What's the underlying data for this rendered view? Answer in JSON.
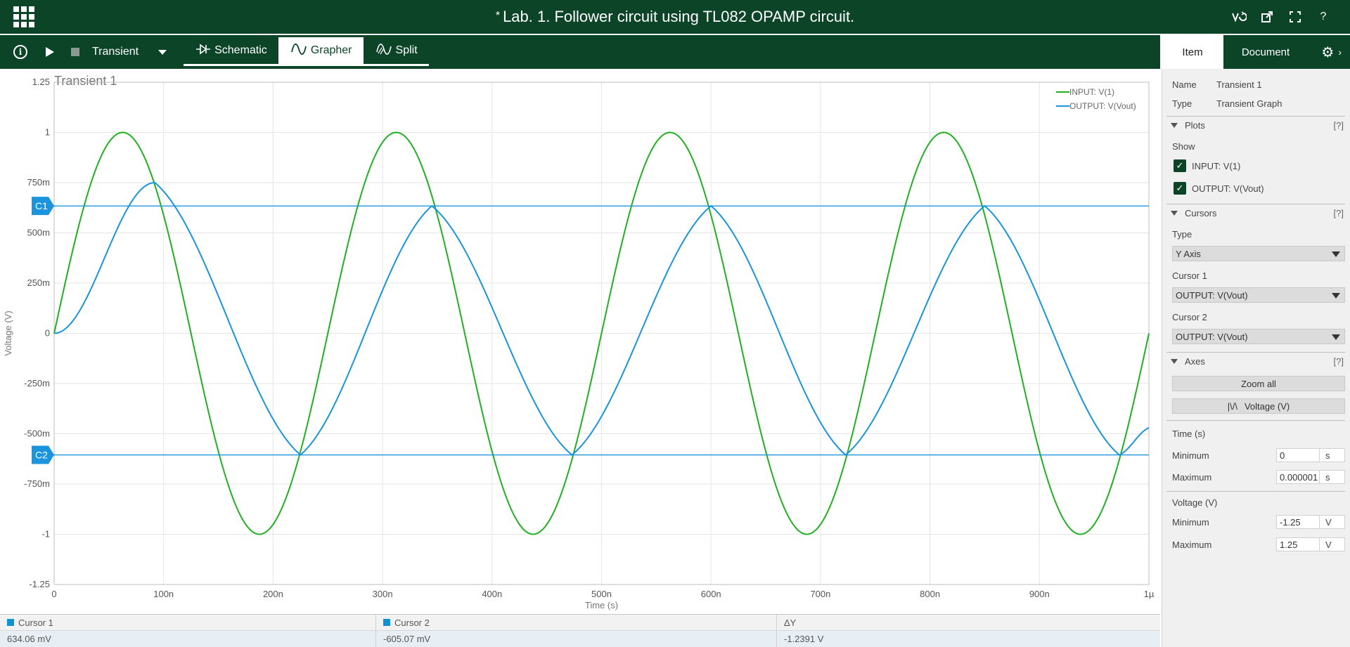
{
  "app": {
    "title": "Lab. 1. Follower circuit using TL082 OPAMP circuit.",
    "modified_marker": "*"
  },
  "toolbar": {
    "simulation": "Transient",
    "tabs": [
      {
        "label": "Schematic",
        "active": false
      },
      {
        "label": "Grapher",
        "active": true
      },
      {
        "label": "Split",
        "active": false
      }
    ]
  },
  "panel_tabs": {
    "item": "Item",
    "document": "Document"
  },
  "chart_data": {
    "type": "line",
    "title": "Transient 1",
    "xlabel": "Time (s)",
    "ylabel": "Voltage (V)",
    "xlim": [
      0,
      1e-06
    ],
    "ylim": [
      -1.25,
      1.25
    ],
    "x_ticks": [
      "0",
      "100n",
      "200n",
      "300n",
      "400n",
      "500n",
      "600n",
      "700n",
      "800n",
      "900n",
      "1µ"
    ],
    "y_ticks": [
      "1.25",
      "1",
      "750m",
      "500m",
      "250m",
      "0",
      "-250m",
      "-500m",
      "-750m",
      "-1",
      "-1.25"
    ],
    "grid": true,
    "legend_position": "top-right",
    "series": [
      {
        "name": "INPUT: V(1)",
        "color": "#21b021",
        "shape": "sine",
        "amplitude": 1.0,
        "frequency_hz": 4000000,
        "x": [
          0,
          6.25e-08,
          1.875e-07,
          3.125e-07,
          4.375e-07,
          5.625e-07,
          6.875e-07,
          8.125e-07,
          9.375e-07,
          1e-06
        ],
        "values": [
          0,
          1,
          -1,
          1,
          -1,
          1,
          -1,
          1,
          -1,
          0
        ]
      },
      {
        "name": "OUTPUT: V(Vout)",
        "color": "#1a94dd",
        "shape": "slew-limited follower",
        "x": [
          0,
          9.2e-08,
          2.25e-07,
          3.45e-07,
          4.73e-07,
          6e-07,
          7.23e-07,
          8.5e-07,
          9.73e-07,
          1e-06
        ],
        "values": [
          0,
          0.75,
          -0.605,
          0.634,
          -0.605,
          0.634,
          -0.605,
          0.634,
          -0.605,
          -0.47
        ]
      }
    ],
    "cursors": [
      {
        "label": "C1",
        "value": 0.63406
      },
      {
        "label": "C2",
        "value": -0.60507
      }
    ]
  },
  "cursor_table": {
    "headers": [
      "Cursor 1",
      "Cursor 2",
      "ΔY"
    ],
    "values": [
      "634.06 mV",
      "-605.07 mV",
      "-1.2391 V"
    ]
  },
  "panel": {
    "name_label": "Name",
    "name_value": "Transient 1",
    "type_label": "Type",
    "type_value": "Transient Graph",
    "plots": {
      "title": "Plots",
      "help": "[?]",
      "show_label": "Show",
      "items": [
        "INPUT: V(1)",
        "OUTPUT: V(Vout)"
      ]
    },
    "cursors": {
      "title": "Cursors",
      "help": "[?]",
      "type_label": "Type",
      "type_value": "Y Axis",
      "cursor1_label": "Cursor 1",
      "cursor1_value": "OUTPUT: V(Vout)",
      "cursor2_label": "Cursor 2",
      "cursor2_value": "OUTPUT: V(Vout)"
    },
    "axes": {
      "title": "Axes",
      "help": "[?]",
      "zoom_all": "Zoom all",
      "voltage_btn": "Voltage (V)",
      "voltage_btn_icon": "|\\/\\",
      "time_label": "Time (s)",
      "time_min_label": "Minimum",
      "time_min": "0",
      "time_min_unit": "s",
      "time_max_label": "Maximum",
      "time_max": "0.000001",
      "time_max_unit": "s",
      "volt_label": "Voltage (V)",
      "volt_min_label": "Minimum",
      "volt_min": "-1.25",
      "volt_min_unit": "V",
      "volt_max_label": "Maximum",
      "volt_max": "1.25",
      "volt_max_unit": "V"
    }
  }
}
